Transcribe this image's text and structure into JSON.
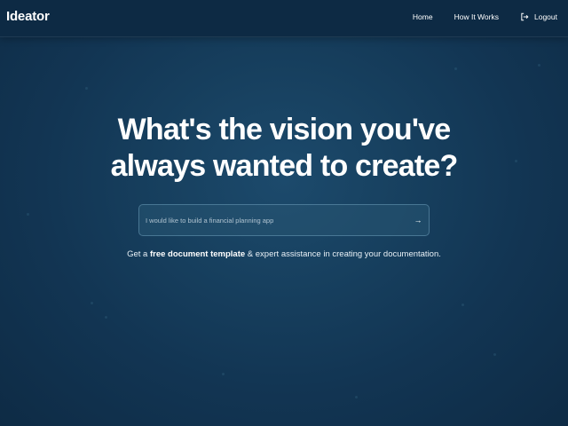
{
  "brand": {
    "name": "Ideator"
  },
  "nav": {
    "home": "Home",
    "how_it_works": "How It Works",
    "logout": "Logout"
  },
  "hero": {
    "title": "What's the vision you've always wanted to create?"
  },
  "prompt": {
    "placeholder": "I would like to build a financial planning app",
    "value": "",
    "submit_icon": "arrow-right-icon",
    "submit_glyph": "→"
  },
  "subtext": {
    "prefix": "Get a ",
    "emphasis": "free document template",
    "suffix": " & expert assistance in creating your documentation."
  },
  "colors": {
    "background": "#17405f",
    "navbar": "#0d2a44",
    "text": "#ffffff"
  }
}
